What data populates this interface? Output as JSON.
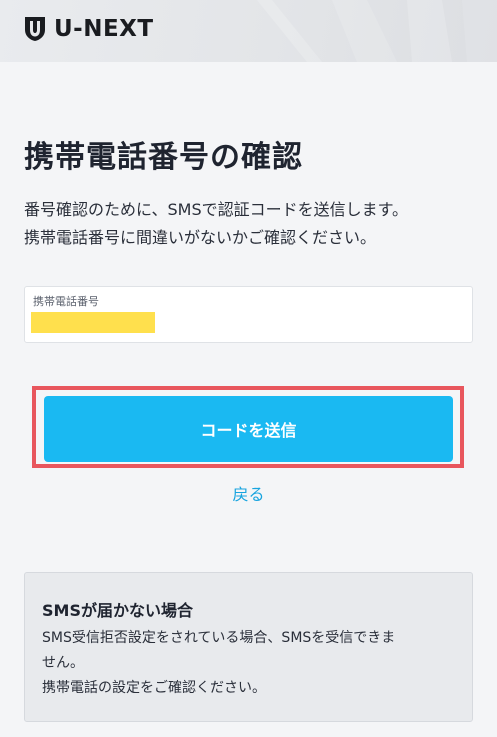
{
  "header": {
    "logo_text": "U-NEXT"
  },
  "main": {
    "title": "携帯電話番号の確認",
    "description_lines": [
      "番号確認のために、SMSで認証コードを送信します。",
      "携帯電話番号に間違いがないかご確認ください。"
    ],
    "phone_field": {
      "label": "携帯電話番号",
      "value_redacted": true
    },
    "send_button_label": "コードを送信",
    "back_link_label": "戻る"
  },
  "info": {
    "title": "SMSが届かない場合",
    "body_lines": [
      "SMS受信拒否設定をされている場合、SMSを受信できま",
      "せん。",
      "携帯電話の設定をご確認ください。"
    ]
  },
  "colors": {
    "accent": "#1ab9f2",
    "link": "#17a4df",
    "highlight_border": "#e8565d",
    "redaction": "#ffe04d",
    "background": "#f4f5f7"
  }
}
